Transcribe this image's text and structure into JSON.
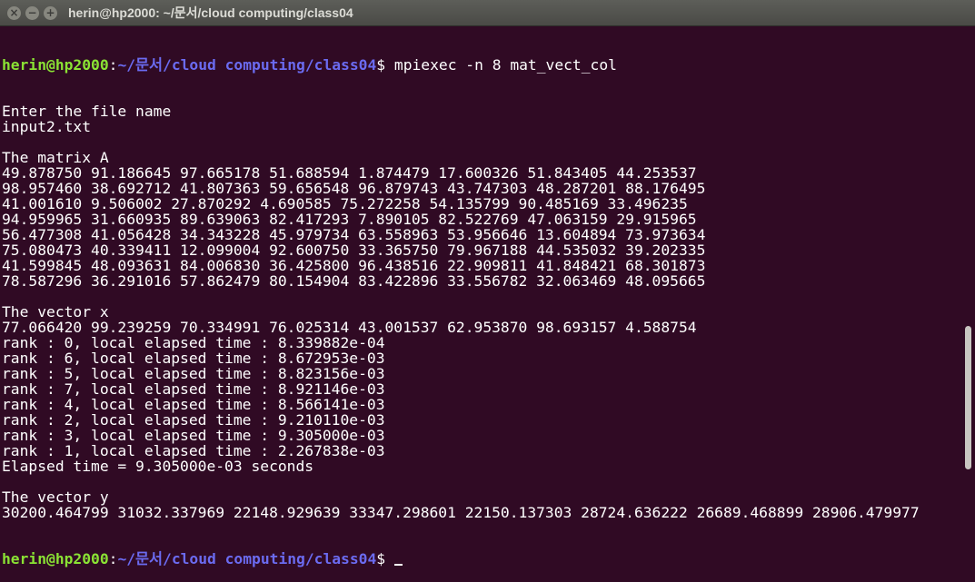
{
  "window": {
    "title": "herin@hp2000: ~/문서/cloud computing/class04",
    "buttons": [
      "×",
      "−",
      "+"
    ]
  },
  "prompt": {
    "user_host": "herin@hp2000",
    "colon": ":",
    "path": "~/문서/cloud computing/class04",
    "dollar": "$ "
  },
  "command": "mpiexec -n 8 mat_vect_col",
  "output": [
    "Enter the file name",
    "input2.txt",
    "",
    "The matrix A",
    "49.878750 91.186645 97.665178 51.688594 1.874479 17.600326 51.843405 44.253537",
    "98.957460 38.692712 41.807363 59.656548 96.879743 43.747303 48.287201 88.176495",
    "41.001610 9.506002 27.870292 4.690585 75.272258 54.135799 90.485169 33.496235",
    "94.959965 31.660935 89.639063 82.417293 7.890105 82.522769 47.063159 29.915965",
    "56.477308 41.056428 34.343228 45.979734 63.558963 53.956646 13.604894 73.973634",
    "75.080473 40.339411 12.099004 92.600750 33.365750 79.967188 44.535032 39.202335",
    "41.599845 48.093631 84.006830 36.425800 96.438516 22.909811 41.848421 68.301873",
    "78.587296 36.291016 57.862479 80.154904 83.422896 33.556782 32.063469 48.095665",
    "",
    "The vector x",
    "77.066420 99.239259 70.334991 76.025314 43.001537 62.953870 98.693157 4.588754",
    "rank : 0, local elapsed time : 8.339882e-04",
    "rank : 6, local elapsed time : 8.672953e-03",
    "rank : 5, local elapsed time : 8.823156e-03",
    "rank : 7, local elapsed time : 8.921146e-03",
    "rank : 4, local elapsed time : 8.566141e-03",
    "rank : 2, local elapsed time : 9.210110e-03",
    "rank : 3, local elapsed time : 9.305000e-03",
    "rank : 1, local elapsed time : 2.267838e-03",
    "Elapsed time = 9.305000e-03 seconds",
    "",
    "The vector y",
    "30200.464799 31032.337969 22148.929639 33347.298601 22150.137303 28724.636222 26689.468899 28906.479977"
  ]
}
